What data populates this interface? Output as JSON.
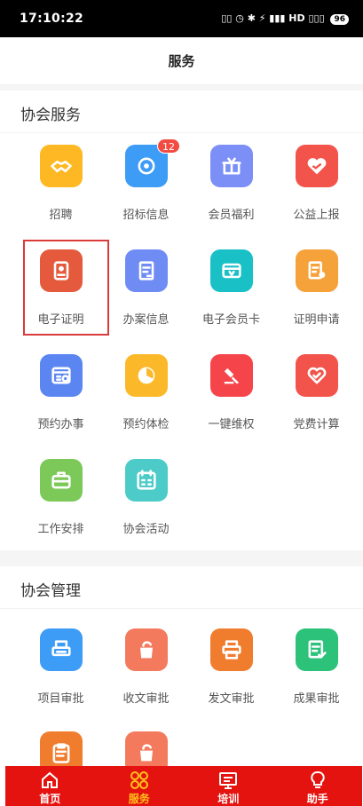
{
  "status_bar": {
    "time": "17:10:22",
    "icons": [
      "sync-icon",
      "alarm-icon",
      "bluetooth-icon",
      "wifi-icon",
      "signal-icon",
      "hd-icon",
      "battery-icon"
    ],
    "right_text": "▯▯ ◷ ✱ ⚡ ▮▮▮ HD ▯▯▯",
    "battery": "96"
  },
  "header": {
    "title": "服务"
  },
  "sections": [
    {
      "title": "协会服务",
      "items": [
        {
          "label": "招聘",
          "icon": "handshake-icon",
          "color": "#FDB824"
        },
        {
          "label": "招标信息",
          "icon": "target-icon",
          "color": "#3D9CF5",
          "badge": "12"
        },
        {
          "label": "会员福利",
          "icon": "gift-icon",
          "color": "#7B8FF7"
        },
        {
          "label": "公益上报",
          "icon": "heart-hand-icon",
          "color": "#F2544B"
        },
        {
          "label": "电子证明",
          "icon": "certificate-icon",
          "color": "#E55A3C"
        },
        {
          "label": "办案信息",
          "icon": "document-icon",
          "color": "#6F8CF5"
        },
        {
          "label": "电子会员卡",
          "icon": "card-icon",
          "color": "#19C1C6"
        },
        {
          "label": "证明申请",
          "icon": "apply-icon",
          "color": "#F6A23A"
        },
        {
          "label": "预约办事",
          "icon": "calendar-clock-icon",
          "color": "#5B86F2"
        },
        {
          "label": "预约体检",
          "icon": "clock-icon",
          "color": "#FBB92A"
        },
        {
          "label": "一键维权",
          "icon": "gavel-icon",
          "color": "#F5454A"
        },
        {
          "label": "党费计算",
          "icon": "heart-icon",
          "color": "#F2544B"
        },
        {
          "label": "工作安排",
          "icon": "briefcase-icon",
          "color": "#7CC95A"
        },
        {
          "label": "协会活动",
          "icon": "calendar-icon",
          "color": "#4CCBC8"
        }
      ]
    },
    {
      "title": "协会管理",
      "items": [
        {
          "label": "项目审批",
          "icon": "printer-icon",
          "color": "#3D9CF5"
        },
        {
          "label": "收文审批",
          "icon": "inbox-icon",
          "color": "#F47A5E"
        },
        {
          "label": "发文审批",
          "icon": "print-out-icon",
          "color": "#F07C2E"
        },
        {
          "label": "成果审批",
          "icon": "approval-icon",
          "color": "#2CC27A"
        },
        {
          "label": "",
          "icon": "clipboard-icon",
          "color": "#F07C2E"
        },
        {
          "label": "",
          "icon": "inbox-icon",
          "color": "#F47A5E"
        }
      ]
    }
  ],
  "tab_bar": {
    "background": "#E5130F",
    "active_color": "#FFC21A",
    "tabs": [
      {
        "label": "首页",
        "icon": "home-icon",
        "active": false
      },
      {
        "label": "服务",
        "icon": "grid-icon",
        "active": true
      },
      {
        "label": "培训",
        "icon": "board-icon",
        "active": false
      },
      {
        "label": "助手",
        "icon": "bulb-icon",
        "active": false
      }
    ]
  }
}
